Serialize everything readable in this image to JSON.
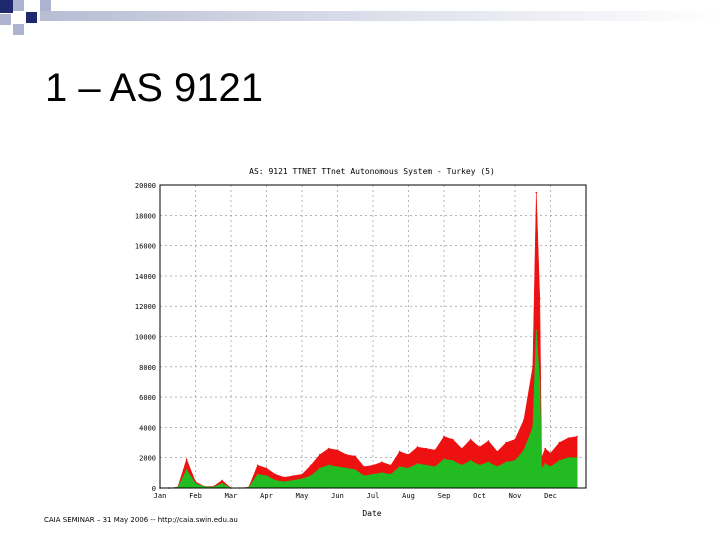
{
  "slide": {
    "title": "1 – AS 9121",
    "footer": "CAIA SEMINAR – 31 May 2006 -- http://caia.swin.edu.au"
  },
  "colors": {
    "deco_dark": "#1f2a6e",
    "deco_light": "#aeb4cf",
    "series_red": "#ee1111",
    "series_green": "#22bb22",
    "grid": "#888888"
  },
  "chart_data": {
    "type": "area",
    "title": "AS: 9121 TTNET TTnet Autonomous System - Turkey (5)",
    "xlabel": "Date",
    "ylabel": "",
    "ylim": [
      0,
      20000
    ],
    "yticks": [
      0,
      2000,
      4000,
      6000,
      8000,
      10000,
      12000,
      14000,
      16000,
      18000,
      20000
    ],
    "xticks": [
      "Jan",
      "Feb",
      "Mar",
      "Apr",
      "May",
      "Jun",
      "Jul",
      "Aug",
      "Sep",
      "Oct",
      "Nov",
      "Dec"
    ],
    "grid": true,
    "x": [
      0,
      0.25,
      0.5,
      0.75,
      1,
      1.25,
      1.5,
      1.75,
      2,
      2.25,
      2.5,
      2.75,
      3,
      3.25,
      3.5,
      3.75,
      4,
      4.25,
      4.5,
      4.75,
      5,
      5.25,
      5.5,
      5.75,
      6,
      6.25,
      6.5,
      6.75,
      7,
      7.25,
      7.5,
      7.75,
      8,
      8.25,
      8.5,
      8.75,
      9,
      9.25,
      9.5,
      9.75,
      10,
      10.25,
      10.5,
      10.6,
      10.7,
      10.75,
      10.85,
      11,
      11.25,
      11.5,
      11.75
    ],
    "series": [
      {
        "values": [
          0,
          0,
          50,
          1900,
          400,
          100,
          100,
          500,
          0,
          0,
          50,
          1500,
          1300,
          900,
          700,
          800,
          900,
          1500,
          2200,
          2600,
          2500,
          2200,
          2100,
          1400,
          1500,
          1700,
          1500,
          2400,
          2200,
          2700,
          2600,
          2500,
          3400,
          3200,
          2600,
          3200,
          2700,
          3100,
          2400,
          3000,
          3200,
          4500,
          8000,
          19500,
          12500,
          2000,
          2600,
          2300,
          3000,
          3300,
          3400
        ]
      },
      {
        "values": [
          0,
          0,
          30,
          1200,
          300,
          80,
          60,
          300,
          0,
          0,
          30,
          900,
          800,
          500,
          400,
          500,
          600,
          800,
          1300,
          1500,
          1400,
          1300,
          1200,
          800,
          900,
          1000,
          900,
          1400,
          1300,
          1600,
          1500,
          1400,
          1900,
          1800,
          1500,
          1800,
          1500,
          1700,
          1400,
          1700,
          1800,
          2500,
          4000,
          10400,
          7000,
          1300,
          1600,
          1400,
          1800,
          2000,
          2000
        ]
      }
    ]
  }
}
